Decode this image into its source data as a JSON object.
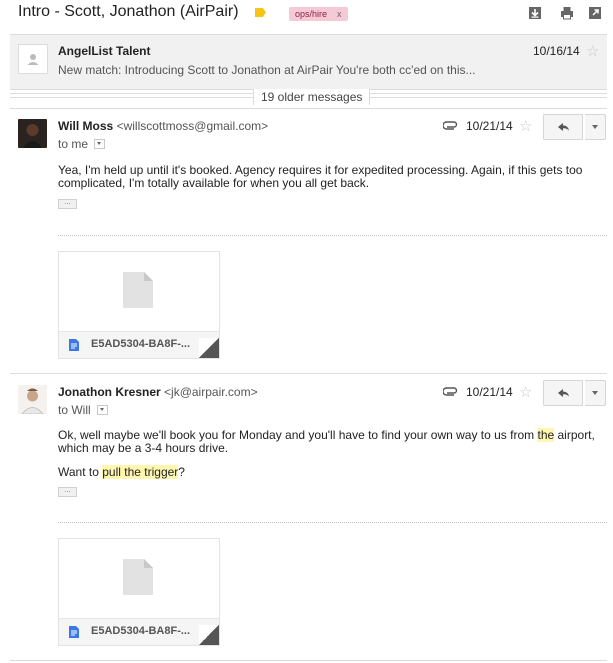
{
  "subject": "Intro - Scott, Jonathon (AirPair)",
  "label": {
    "text": "ops/hire",
    "remove": "x"
  },
  "header_icons": [
    "download-icon",
    "print-icon",
    "new-window-icon"
  ],
  "collapsed": {
    "sender": "AngelList Talent",
    "snippet": "New match: Introducing Scott to Jonathon at AirPair You're both cc'ed on this...",
    "date": "10/16/14"
  },
  "older": "19 older messages",
  "messages": [
    {
      "sender": "Will Moss",
      "email": "<willscottmoss@gmail.com>",
      "to": "to me",
      "date": "10/21/14",
      "body": [
        "Yea, I'm held up until it's booked. Agency requires it for expedited processing. Again, if this gets too complicated, I'm totally available for when you all get back."
      ],
      "attachment": "E5AD5304-BA8F-..."
    },
    {
      "sender": "Jonathon Kresner",
      "email": "<jk@airpair.com>",
      "to": "to Will",
      "date": "10/21/14",
      "body_l1_a": "Ok, well maybe we'll book you for Monday and you'll have to find your own way to us from ",
      "body_l1_hl": "the",
      "body_l1_b": " airport,",
      "body_l2": "which may be a 3-4 hours drive.",
      "body_l3_a": "Want to ",
      "body_l3_hl": "pull the trigger",
      "body_l3_b": "?",
      "attachment": "E5AD5304-BA8F-..."
    }
  ]
}
